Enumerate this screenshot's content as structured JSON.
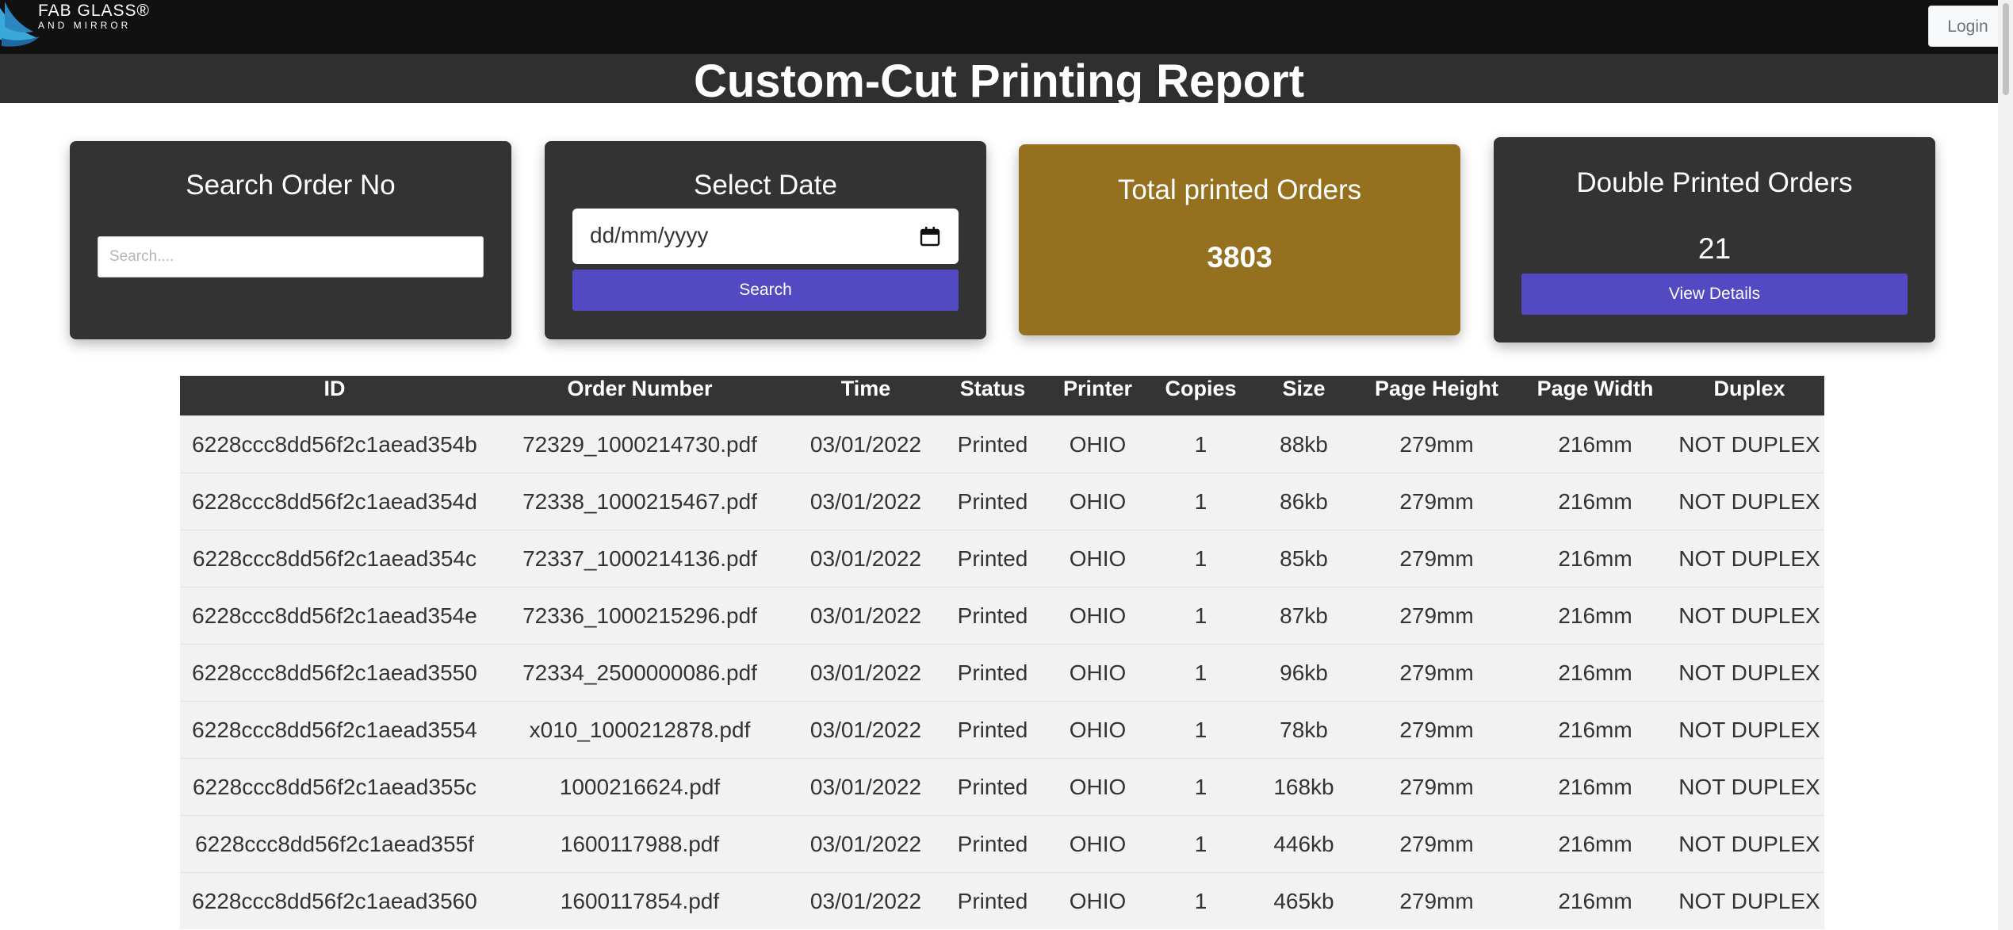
{
  "brand": {
    "line1": "FAB GLASS®",
    "line2": "AND MIRROR"
  },
  "navbar": {
    "login_label": "Login"
  },
  "page_title": "Custom-Cut Printing Report",
  "search_card": {
    "title": "Search Order No",
    "placeholder": "Search...."
  },
  "date_card": {
    "title": "Select Date",
    "date_placeholder": "dd/mm/yyyy",
    "button_label": "Search"
  },
  "total_card": {
    "title": "Total printed Orders",
    "value": "3803"
  },
  "double_card": {
    "title": "Double Printed Orders",
    "value": "21",
    "button_label": "View Details"
  },
  "colors": {
    "card_dark": "#333333",
    "total_card_gold": "#94701f",
    "button_purple": "#5349c2"
  },
  "table": {
    "headers": [
      "ID",
      "Order Number",
      "Time",
      "Status",
      "Printer",
      "Copies",
      "Size",
      "Page Height",
      "Page Width",
      "Duplex"
    ],
    "rows": [
      [
        "6228ccc8dd56f2c1aead354b",
        "72329_1000214730.pdf",
        "03/01/2022",
        "Printed",
        "OHIO",
        "1",
        "88kb",
        "279mm",
        "216mm",
        "NOT DUPLEX"
      ],
      [
        "6228ccc8dd56f2c1aead354d",
        "72338_1000215467.pdf",
        "03/01/2022",
        "Printed",
        "OHIO",
        "1",
        "86kb",
        "279mm",
        "216mm",
        "NOT DUPLEX"
      ],
      [
        "6228ccc8dd56f2c1aead354c",
        "72337_1000214136.pdf",
        "03/01/2022",
        "Printed",
        "OHIO",
        "1",
        "85kb",
        "279mm",
        "216mm",
        "NOT DUPLEX"
      ],
      [
        "6228ccc8dd56f2c1aead354e",
        "72336_1000215296.pdf",
        "03/01/2022",
        "Printed",
        "OHIO",
        "1",
        "87kb",
        "279mm",
        "216mm",
        "NOT DUPLEX"
      ],
      [
        "6228ccc8dd56f2c1aead3550",
        "72334_2500000086.pdf",
        "03/01/2022",
        "Printed",
        "OHIO",
        "1",
        "96kb",
        "279mm",
        "216mm",
        "NOT DUPLEX"
      ],
      [
        "6228ccc8dd56f2c1aead3554",
        "x010_1000212878.pdf",
        "03/01/2022",
        "Printed",
        "OHIO",
        "1",
        "78kb",
        "279mm",
        "216mm",
        "NOT DUPLEX"
      ],
      [
        "6228ccc8dd56f2c1aead355c",
        "1000216624.pdf",
        "03/01/2022",
        "Printed",
        "OHIO",
        "1",
        "168kb",
        "279mm",
        "216mm",
        "NOT DUPLEX"
      ],
      [
        "6228ccc8dd56f2c1aead355f",
        "1600117988.pdf",
        "03/01/2022",
        "Printed",
        "OHIO",
        "1",
        "446kb",
        "279mm",
        "216mm",
        "NOT DUPLEX"
      ],
      [
        "6228ccc8dd56f2c1aead3560",
        "1600117854.pdf",
        "03/01/2022",
        "Printed",
        "OHIO",
        "1",
        "465kb",
        "279mm",
        "216mm",
        "NOT DUPLEX"
      ]
    ]
  }
}
